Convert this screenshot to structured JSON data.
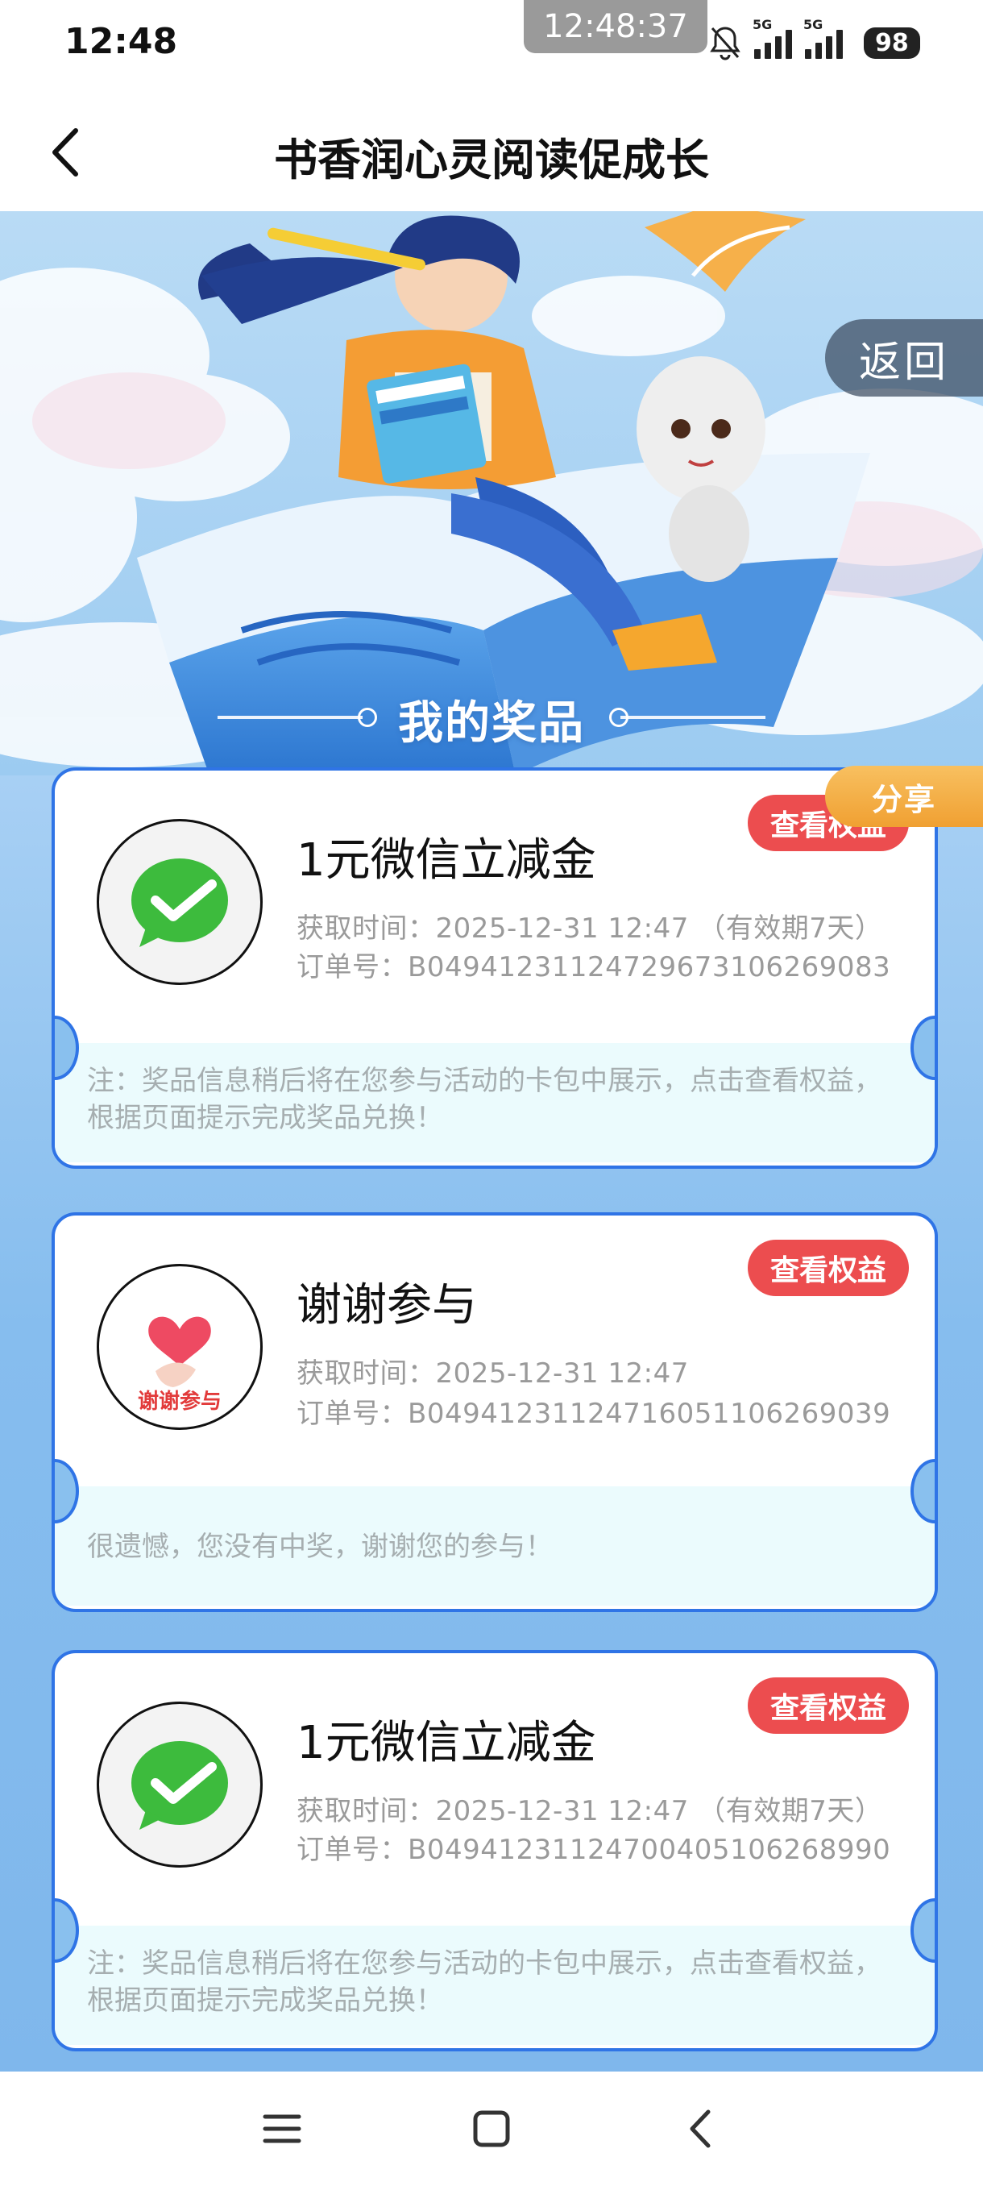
{
  "status_bar": {
    "time": "12:48",
    "clock_chip": "12:48:37",
    "network_1": "5G",
    "network_2": "5G",
    "battery": "98"
  },
  "header": {
    "title": "书香润心灵阅读促成长"
  },
  "banner": {
    "return_label": "返回",
    "section_title": "我的奖品",
    "share_label": "分享"
  },
  "prizes": [
    {
      "name": "1元微信立减金",
      "icon": "wechat-icon",
      "time_line": "获取时间：2025-12-31 12:47 （有效期7天）",
      "order_line": "订单号：B04941231124729673106269083",
      "button_label": "查看权益",
      "note": "注：奖品信息稍后将在您参与活动的卡包中展示，点击查看权益，根据页面提示完成奖品兑换！"
    },
    {
      "name": "谢谢参与",
      "icon": "thanks-heart-icon",
      "icon_text": "谢谢参与",
      "time_line": "获取时间：2025-12-31 12:47",
      "order_line": "订单号：B04941231124716051106269039",
      "button_label": "查看权益",
      "note": "很遗憾，您没有中奖，谢谢您的参与！"
    },
    {
      "name": "1元微信立减金",
      "icon": "wechat-icon",
      "time_line": "获取时间：2025-12-31 12:47 （有效期7天）",
      "order_line": "订单号：B04941231124700405106268990",
      "button_label": "查看权益",
      "note": "注：奖品信息稍后将在您参与活动的卡包中展示，点击查看权益，根据页面提示完成奖品兑换！"
    }
  ],
  "colors": {
    "accent_blue": "#2f74e6",
    "button_red": "#ec4d4f",
    "share_orange": "#f0a032",
    "wechat_green": "#3dbb3d"
  }
}
